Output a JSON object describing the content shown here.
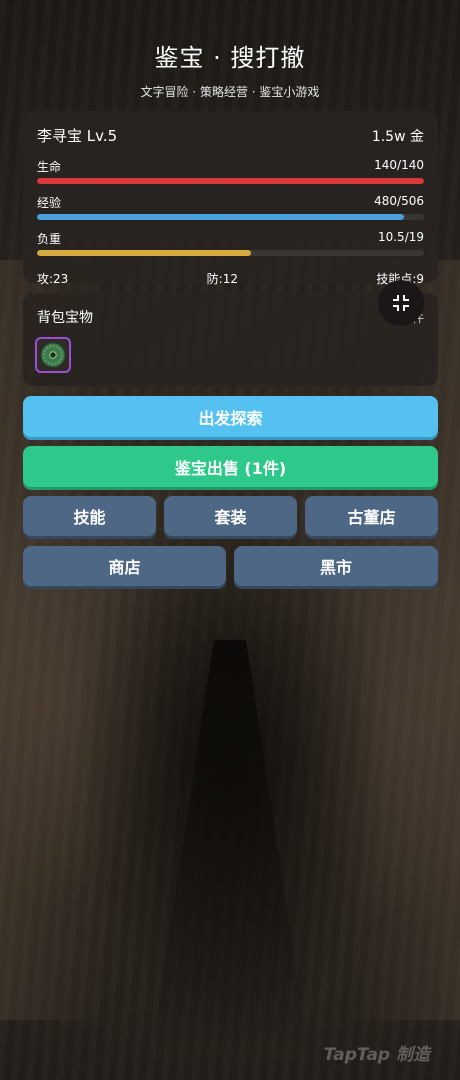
{
  "header": {
    "title": "鉴宝 · 搜打撤",
    "subtitle": "文字冒险 · 策略经营 · 鉴宝小游戏"
  },
  "player": {
    "name": "李寻宝 Lv.5",
    "gold": "1.5w 金"
  },
  "bars": {
    "hp": {
      "label": "生命",
      "value": "140/140",
      "fraction": 1.0,
      "color": "#d9393b"
    },
    "exp": {
      "label": "经验",
      "value": "480/506",
      "fraction": 0.949,
      "color": "#4aa0dc"
    },
    "load": {
      "label": "负重",
      "value": "10.5/19",
      "fraction": 0.553,
      "color": "#d6aa3f"
    }
  },
  "attrs": {
    "attack": "攻:23",
    "defense": "防:12",
    "skill_points": "技能点:9"
  },
  "bag": {
    "title": "背包宝物",
    "count": "1 件",
    "items": [
      {
        "icon": "jade-disc-icon",
        "rarity_color": "#9c4fd0"
      }
    ]
  },
  "buttons": {
    "explore": "出发探索",
    "sell": "鉴宝出售 (1件)",
    "skills": "技能",
    "sets": "套装",
    "antique_shop": "古董店",
    "shop": "商店",
    "black_market": "黑市"
  },
  "watermark": "TapTap 制造"
}
